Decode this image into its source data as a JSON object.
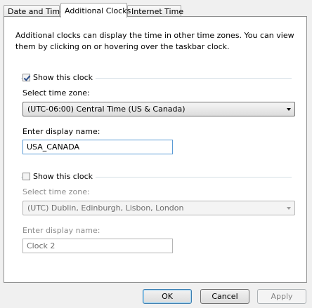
{
  "tabs": [
    {
      "label": "Date and Time"
    },
    {
      "label": "Additional Clocks"
    },
    {
      "label": "Internet Time"
    }
  ],
  "intro_text": "Additional clocks can display the time in other time zones. You can view them by clicking on or hovering over the taskbar clock.",
  "clock1": {
    "show_label": "Show this clock",
    "checked": true,
    "timezone_label": "Select time zone:",
    "timezone_value": "(UTC-06:00) Central Time (US & Canada)",
    "name_label": "Enter display name:",
    "name_value": "USA_CANADA"
  },
  "clock2": {
    "show_label": "Show this clock",
    "checked": false,
    "timezone_label": "Select time zone:",
    "timezone_value": "(UTC) Dublin, Edinburgh, Lisbon, London",
    "name_label": "Enter display name:",
    "name_value": "Clock 2"
  },
  "buttons": {
    "ok": "OK",
    "cancel": "Cancel",
    "apply": "Apply"
  }
}
